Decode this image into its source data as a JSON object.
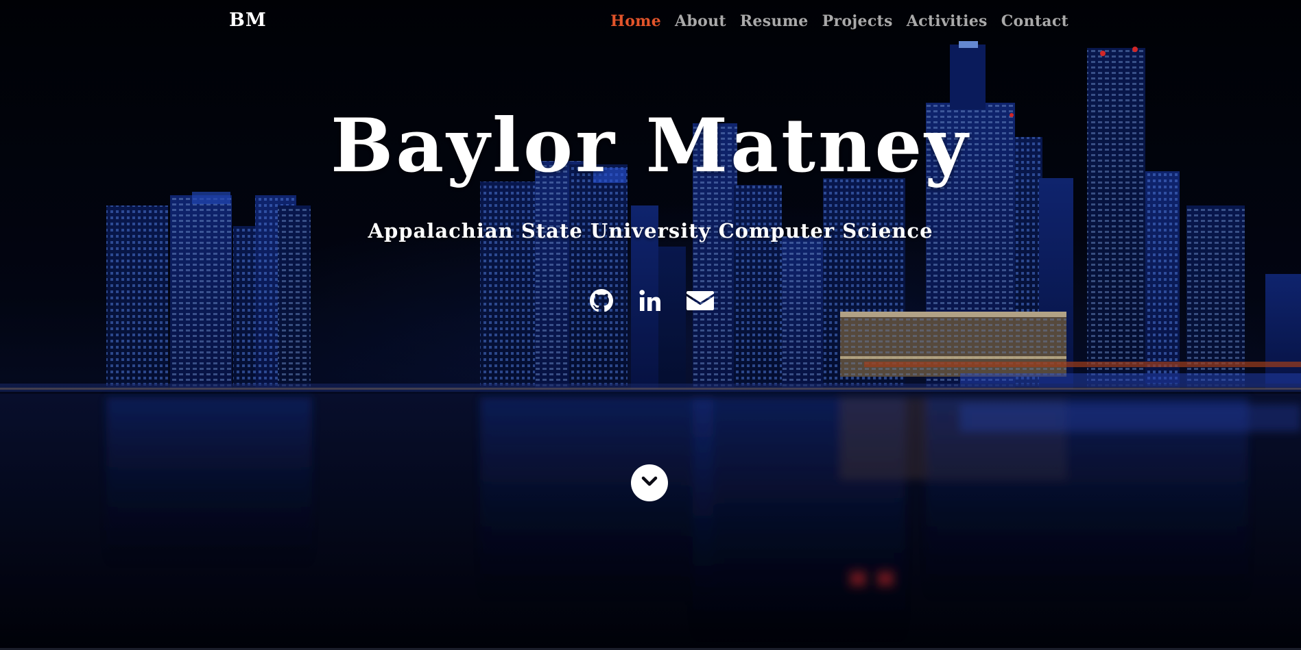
{
  "brand": "BM",
  "nav": {
    "items": [
      {
        "label": "Home",
        "active": true
      },
      {
        "label": "About",
        "active": false
      },
      {
        "label": "Resume",
        "active": false
      },
      {
        "label": "Projects",
        "active": false
      },
      {
        "label": "Activities",
        "active": false
      },
      {
        "label": "Contact",
        "active": false
      }
    ]
  },
  "hero": {
    "name": "Baylor Matney",
    "subtitle": "Appalachian State University Computer Science"
  },
  "social": [
    {
      "icon": "github-icon"
    },
    {
      "icon": "linkedin-icon"
    },
    {
      "icon": "envelope-icon"
    }
  ],
  "scroll_button": {
    "icon": "chevron-down-icon"
  },
  "colors": {
    "active_nav": "#e2542a",
    "nav_text": "#a9a9a9",
    "text": "#ffffff",
    "background": "#02030a"
  }
}
